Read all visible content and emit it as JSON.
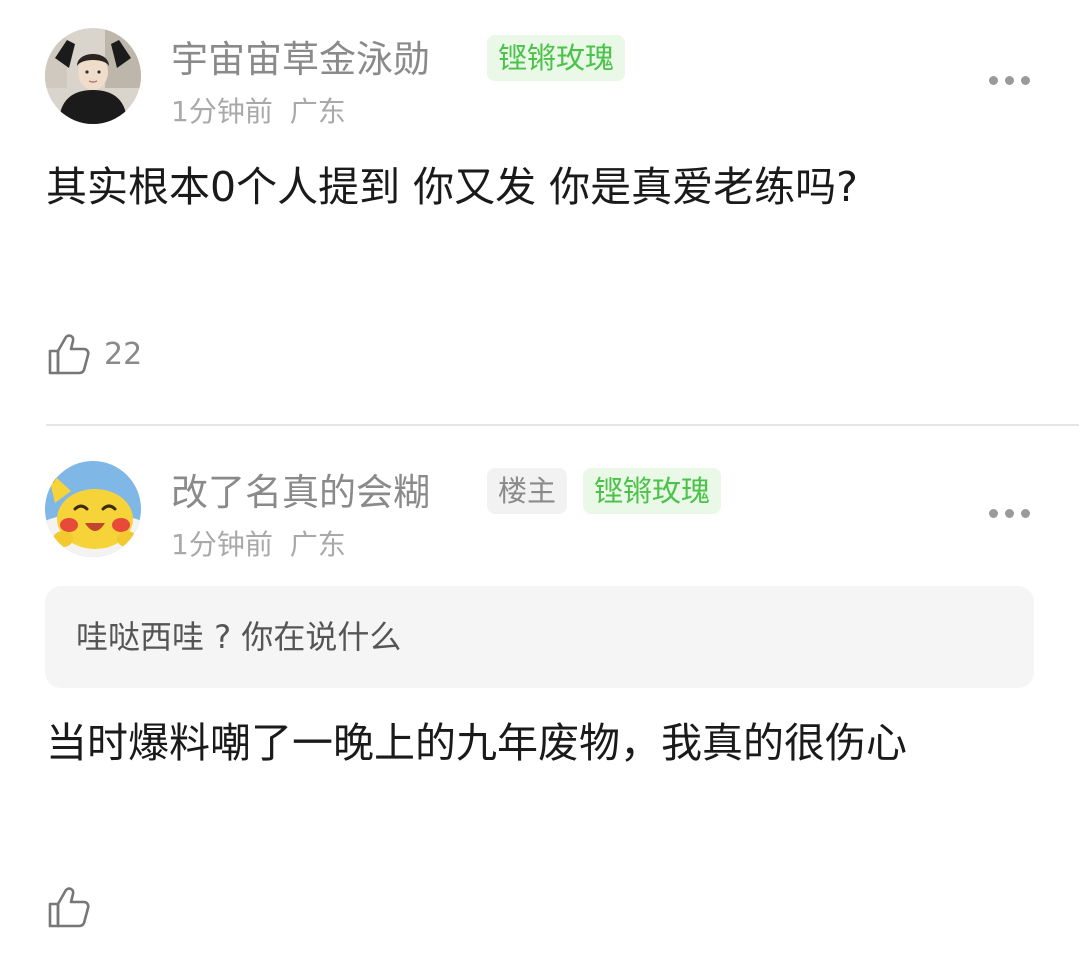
{
  "comments": [
    {
      "username": "宇宙宙草金泳勋",
      "badges": [
        "铿锵玫瑰"
      ],
      "time": "1分钟前",
      "location": "广东",
      "text": "其实根本0个人提到 你又发 你是真爱老练吗?",
      "likes": "22",
      "avatar_icon": "person-photo-avatar",
      "more_icon": "more-dots-icon",
      "like_icon": "thumbs-up-icon"
    },
    {
      "username": "改了名真的会糊",
      "op_tag": "楼主",
      "badges": [
        "铿锵玫瑰"
      ],
      "time": "1分钟前",
      "location": "广东",
      "quote": "哇哒西哇 ? 你在说什么",
      "text": "当时爆料嘲了一晚上的九年废物，我真的很伤心",
      "likes": "",
      "avatar_icon": "pikachu-avatar",
      "more_icon": "more-dots-icon",
      "like_icon": "thumbs-up-icon"
    }
  ],
  "colors": {
    "badge_text": "#4cc24a",
    "badge_bg": "#e9f8e7",
    "username": "#8a8a8a",
    "meta": "#a9a9a9",
    "divider": "#e6e6e6",
    "quote_bg": "#f5f5f5"
  }
}
